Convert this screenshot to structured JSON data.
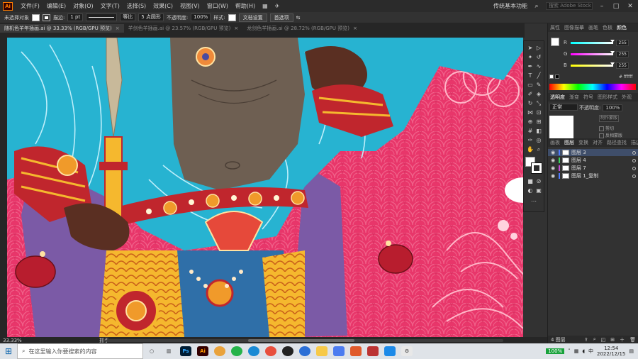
{
  "menubar": {
    "logo": "Ai",
    "items": [
      "文件(F)",
      "编辑(E)",
      "对象(O)",
      "文字(T)",
      "选择(S)",
      "效果(C)",
      "视图(V)",
      "窗口(W)",
      "帮助(H)"
    ],
    "workspace": "传统基本功能",
    "search_placeholder": "搜索 Adobe Stock"
  },
  "controlbar": {
    "selection_label": "未选择对象",
    "stroke_label": "描边:",
    "stroke_weight": "1 pt",
    "stroke_style": "等比",
    "brush": "5 点圆形",
    "opacity_label": "不透明度:",
    "opacity": "100%",
    "style_label": "样式:",
    "doc_setup": "文档设置",
    "prefs": "首选项"
  },
  "tabs": [
    {
      "label": "随机色羊年插画.ai @ 33.33% (RGB/GPU 预览)",
      "active": true
    },
    {
      "label": "羊剑色羊插画.ai @ 23.57% (RGB/GPU 预览)",
      "active": false
    },
    {
      "label": "龙剑色羊插画.ai @ 28.72% (RGB/GPU 预览)",
      "active": false
    }
  ],
  "status": {
    "zoom": "33.33%",
    "tool": "抓手"
  },
  "color_panel": {
    "tabs": [
      "属性",
      "图像描摹",
      "画笔",
      "色板",
      "颜色"
    ],
    "channels": [
      {
        "name": "R",
        "value": "255"
      },
      {
        "name": "G",
        "value": "255"
      },
      {
        "name": "B",
        "value": "255"
      }
    ],
    "hex": "# ffffff"
  },
  "transparency_panel": {
    "tabs": [
      "透明度",
      "渐变",
      "符号",
      "图形样式",
      "外观"
    ],
    "mode": "正常",
    "opacity_label": "不透明度:",
    "opacity": "100%",
    "make_mask": "制作蒙版",
    "clip": "剪切",
    "invert_mask": "反相蒙版"
  },
  "layers_panel": {
    "tabs": [
      "画板",
      "图层",
      "变换",
      "对齐",
      "路径查找",
      "描边"
    ],
    "layers": [
      {
        "name": "图层 3",
        "color": "#4f7bff",
        "selected": true
      },
      {
        "name": "图层 4",
        "color": "#3dd15e",
        "selected": false
      },
      {
        "name": "图层 7",
        "color": "#c44dd4",
        "selected": false
      },
      {
        "name": "图层 1_复制",
        "color": "#4f7bff",
        "selected": false
      }
    ],
    "count": "4 图层"
  },
  "taskbar": {
    "search_placeholder": "在这里输入你要搜索的内容",
    "battery": "100%",
    "ime": "中",
    "time": "12:54",
    "date": "2022/12/15"
  }
}
